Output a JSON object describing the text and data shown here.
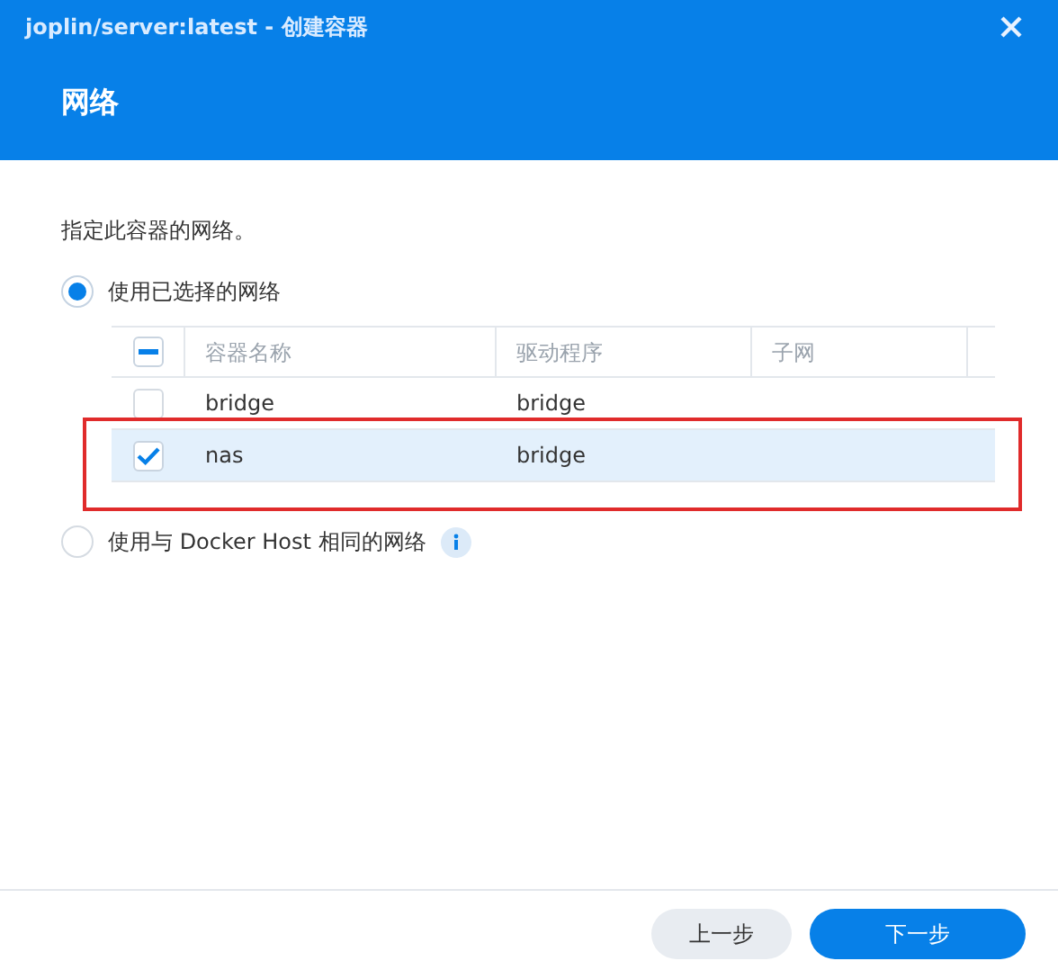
{
  "window": {
    "title": "joplin/server:latest - 创建容器"
  },
  "header": {
    "title": "网络"
  },
  "description": "指定此容器的网络。",
  "options": [
    {
      "label": "使用已选择的网络",
      "selected": true,
      "info": false
    },
    {
      "label": "使用与 Docker Host 相同的网络",
      "selected": false,
      "info": true
    }
  ],
  "table": {
    "select_all": {
      "indeterminate": true
    },
    "columns": [
      "容器名称",
      "驱动程序",
      "子网"
    ],
    "rows": [
      {
        "cells": [
          "bridge",
          "bridge"
        ],
        "checked": false,
        "selected": false,
        "highlighted": false
      },
      {
        "cells": [
          "nas",
          "bridge"
        ],
        "checked": true,
        "selected": true,
        "highlighted": true
      }
    ]
  },
  "buttons": [
    {
      "label": "上一步",
      "kind": "secondary"
    },
    {
      "label": "下一步",
      "kind": "primary"
    }
  ]
}
